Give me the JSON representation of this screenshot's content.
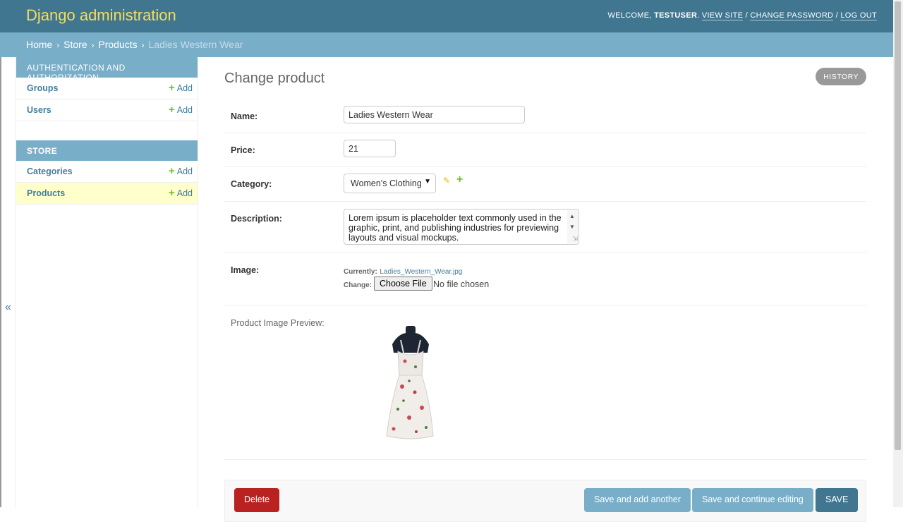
{
  "header": {
    "branding": "Django administration",
    "welcome_prefix": "WELCOME,",
    "username": "TESTUSER",
    "period": ".",
    "view_site": "VIEW SITE",
    "slash": "/",
    "change_password": "CHANGE PASSWORD",
    "log_out": "LOG OUT"
  },
  "breadcrumbs": {
    "items": [
      "Home",
      "Store",
      "Products"
    ],
    "current": "Ladies Western Wear",
    "separator": "›"
  },
  "nav_toggle": {
    "icon": "«"
  },
  "sidebar": {
    "modules": [
      {
        "caption": "AUTHENTICATION AND AUTHORIZATION",
        "models": [
          {
            "name": "Groups",
            "add_label": "Add"
          },
          {
            "name": "Users",
            "add_label": "Add"
          }
        ]
      },
      {
        "caption": "STORE",
        "models": [
          {
            "name": "Categories",
            "add_label": "Add"
          },
          {
            "name": "Products",
            "add_label": "Add"
          }
        ]
      }
    ],
    "current_model": "Products",
    "plus_icon": "+"
  },
  "content": {
    "title": "Change product",
    "history_label": "HISTORY",
    "fields": {
      "name": {
        "label": "Name:",
        "value": "Ladies Western Wear"
      },
      "price": {
        "label": "Price:",
        "value": "21"
      },
      "category": {
        "label": "Category:",
        "selected": "Women's Clothing"
      },
      "description": {
        "label": "Description:",
        "value": "Lorem ipsum is placeholder text commonly used in the graphic, print, and publishing industries for previewing layouts and visual mockups."
      },
      "image": {
        "label": "Image:",
        "currently_label": "Currently:",
        "current_file": "Ladies_Western_Wear.jpg",
        "change_label": "Change:",
        "choose_file_label": "Choose File",
        "no_file_text": "No file chosen"
      }
    },
    "preview_label": "Product Image Preview:"
  },
  "submit_row": {
    "delete": "Delete",
    "save_add_another": "Save and add another",
    "save_continue": "Save and continue editing",
    "save": "SAVE"
  },
  "colors": {
    "header_bg": "#417690",
    "branding": "#f5dd5d",
    "breadcrumbs_bg": "#79aec8",
    "link": "#447e9b",
    "add_green": "#70bf2b",
    "delete_red": "#ba2121",
    "current_row": "#ffffcc"
  },
  "icons": {
    "collapse": "double-left-chevron-icon",
    "edit": "pencil-icon",
    "add": "plus-icon",
    "select_caret": "chevron-down-icon"
  }
}
